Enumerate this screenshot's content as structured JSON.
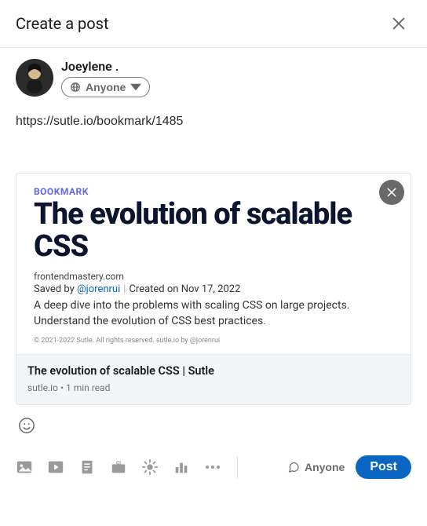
{
  "header": {
    "title": "Create a post"
  },
  "profile": {
    "name": "Joeylene .",
    "visibility_label": "Anyone"
  },
  "editor": {
    "url": "https://sutle.io/bookmark/1485"
  },
  "preview": {
    "badge": "BOOKMARK",
    "headline": "The evolution of scalable CSS",
    "source_domain": "frontendmastery.com",
    "saved_prefix": "Saved by ",
    "saved_handle": "@jorenrui",
    "created_prefix": "Created on ",
    "created_date": "Nov 17, 2022",
    "description": "A deep dive into the problems with scaling CSS on large projects. Understand the evolution of CSS best practices.",
    "copyright": "© 2021-2022 Sutle. All rights reserved. sutle.io by @jorenrui",
    "card_title": "The evolution of scalable CSS | Sutle",
    "card_domain": "sutle.io",
    "card_readtime": "1 min read"
  },
  "footer": {
    "comment_scope": "Anyone",
    "post_label": "Post"
  }
}
